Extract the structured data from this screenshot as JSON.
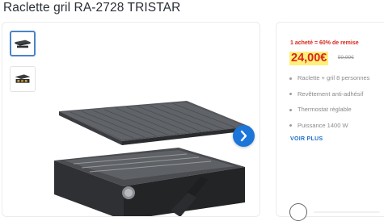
{
  "product": {
    "title": "Raclette gril RA-2728 TRISTAR"
  },
  "gallery": {
    "thumbnails": [
      {
        "name": "raclette-grill-thumbnail",
        "selected": true
      },
      {
        "name": "raclette-grill-angle-thumbnail",
        "selected": false
      }
    ],
    "next_icon": "chevron-right-icon",
    "accent_color": "#1c75d8"
  },
  "offer": {
    "promo_text": "1 acheté = 60% de remise",
    "price": "24,00€",
    "old_price": "59,99€",
    "price_color": "#d8261d",
    "price_highlight": "#fff07a"
  },
  "features": [
    "Raclette + gril 8 personnes",
    "Revêtement anti-adhésif",
    "Thermostat réglable",
    "Puissance 1400 W"
  ],
  "actions": {
    "more_label": "VOIR PLUS"
  }
}
